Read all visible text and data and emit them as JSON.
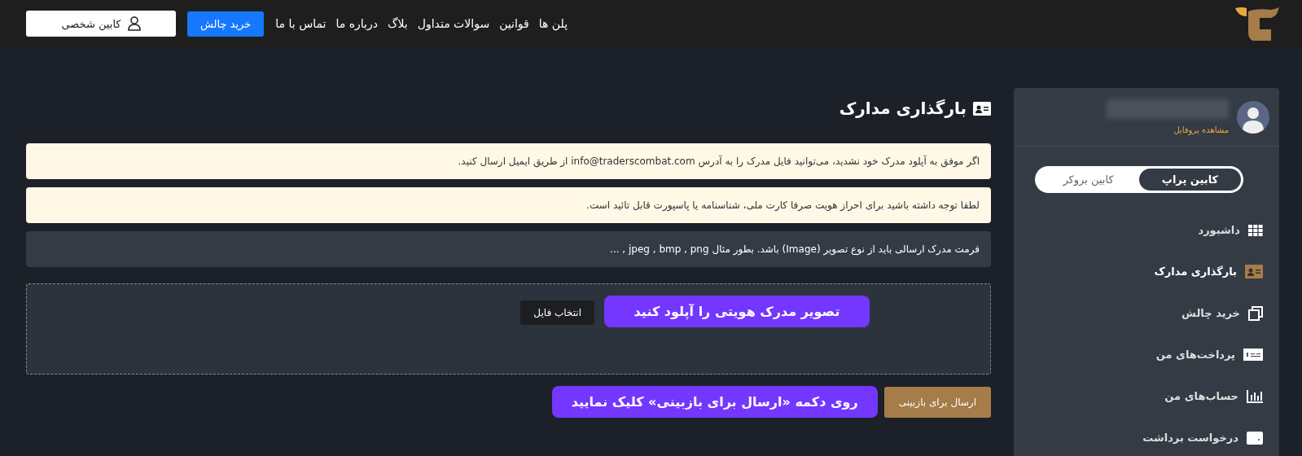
{
  "header": {
    "nav": [
      "پلن ها",
      "قوانین",
      "سوالات متداول",
      "بلاگ",
      "درباره ما",
      "تماس با ما"
    ],
    "buy_button": "خرید چالش",
    "cabinet_button": "کابین شخصی"
  },
  "sidebar": {
    "profile_link": "مشاهده پروفایل",
    "cabinet_tabs": [
      {
        "label": "کابین پراپ",
        "selected": true
      },
      {
        "label": "کابین بروکر",
        "selected": false
      }
    ],
    "items": [
      {
        "label": "داشبورد",
        "kind": "grid",
        "selected": false
      },
      {
        "label": "بارگذاری مدارک",
        "kind": "card",
        "selected": true
      },
      {
        "label": "خرید چالش",
        "kind": "windows",
        "selected": false
      },
      {
        "label": "پرداخت‌های من",
        "kind": "bill",
        "selected": false
      },
      {
        "label": "حساب‌های من",
        "kind": "chart",
        "selected": false
      },
      {
        "label": "درخواست برداشت",
        "kind": "wallet",
        "selected": false
      }
    ]
  },
  "page_title": "بارگذاری مدارک",
  "alerts": [
    {
      "kind": "warning",
      "text": "اگر موفق به آپلود مدرک خود نشدید، می‌توانید فایل مدرک را به آدرس info@traderscombat.com از طریق ایمیل ارسال کنید."
    },
    {
      "kind": "warning",
      "text": "لطفا توجه داشته باشید برای احراز هویت صرفا کارت ملی، شناسنامه یا پاسپورت قابل تائید است."
    },
    {
      "kind": "info",
      "text": "فرمت مدرک ارسالی باید از نوع تصویر (Image) باشد. بطور مثال jpeg , bmp , png , ..."
    }
  ],
  "upload": {
    "choose_button": "انتخاب فایل",
    "callout": "تصویر مدرک هویتی را آپلود کنید"
  },
  "submit_button": "ارسال برای بازبینی",
  "submit_callout": "روی دکمه «ارسال برای بازبینی» کلیک نمایید"
}
